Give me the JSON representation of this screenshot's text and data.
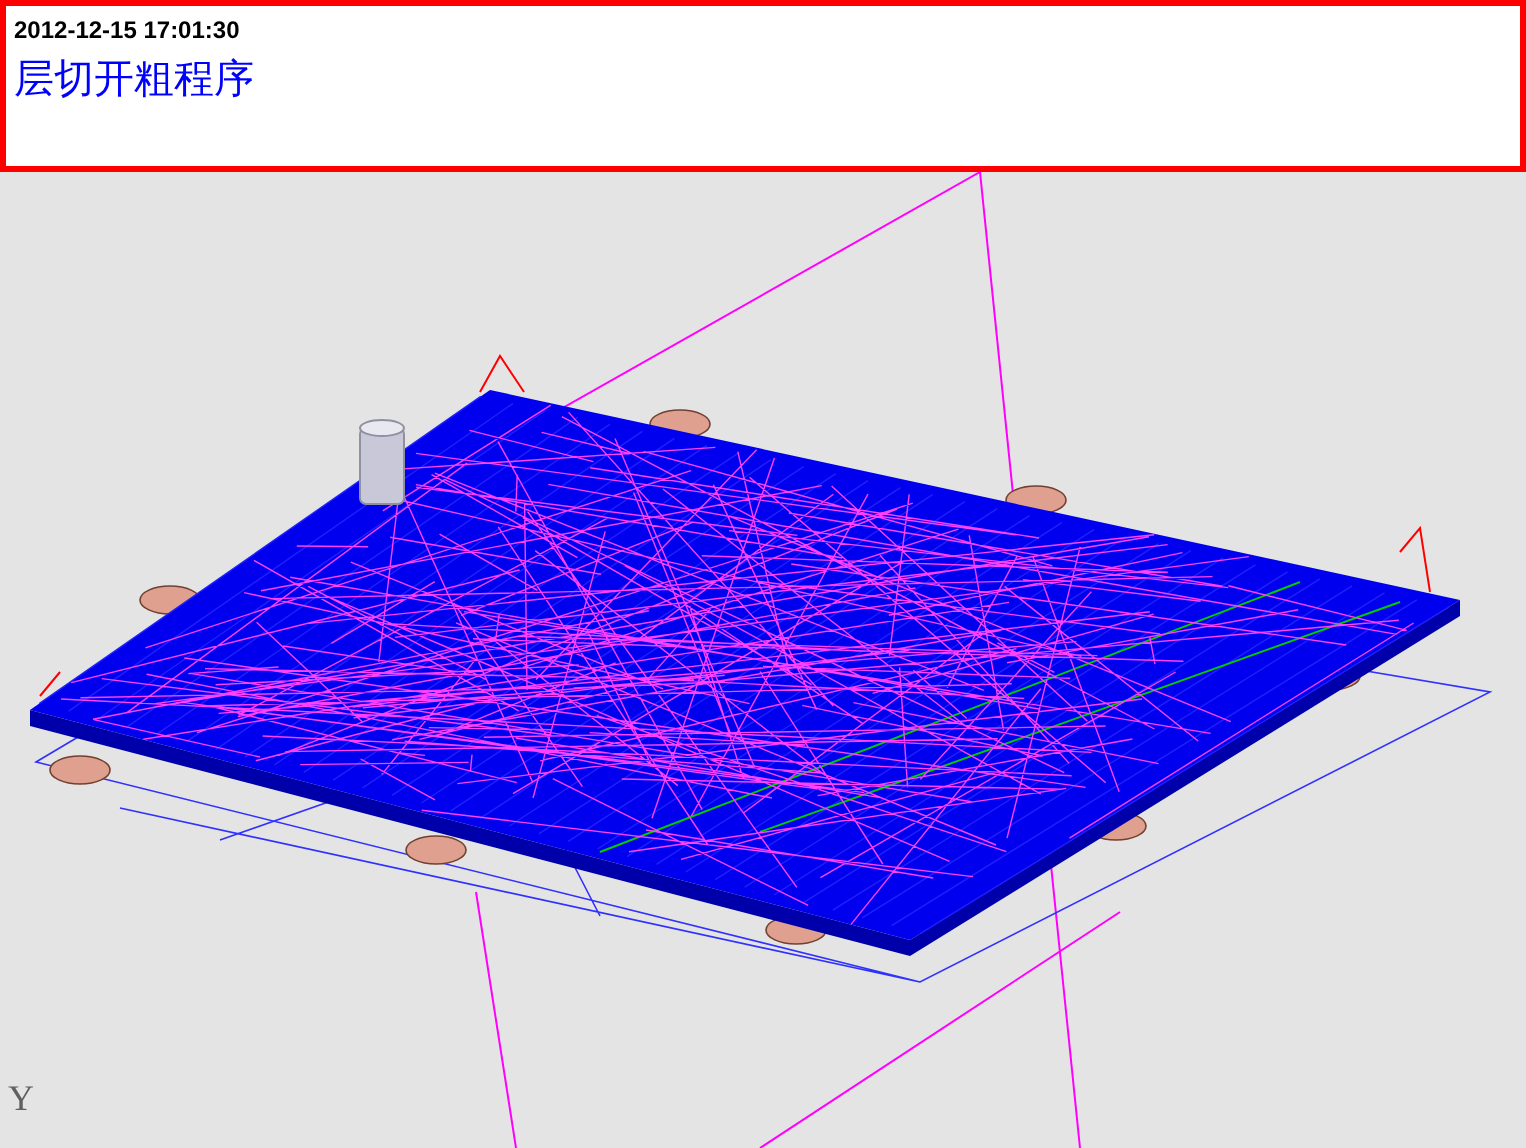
{
  "header": {
    "timestamp": "2012-12-15 17:01:30",
    "title": "层切开粗程序"
  },
  "viewport": {
    "axis_label": "Y"
  }
}
